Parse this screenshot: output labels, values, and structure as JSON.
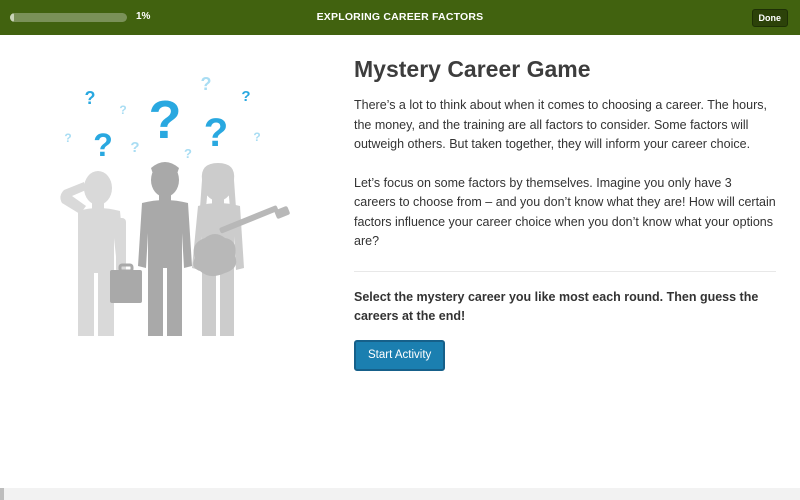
{
  "header": {
    "progress": {
      "value": 0.01,
      "label": "1%"
    },
    "title": "EXPLORING CAREER FACTORS",
    "done_label": "Done"
  },
  "colors": {
    "header_bg": "#41620f",
    "button_blue": "#1b7fb0",
    "question_blue": "#29a8e0",
    "silhouette_gray": "#cfcfcf"
  },
  "illustration": {
    "icons": [
      "question-mark-icon",
      "person-thinking-silhouette",
      "person-briefcase-silhouette",
      "person-guitar-silhouette"
    ]
  },
  "main": {
    "title": "Mystery Career Game",
    "paragraphs": [
      "There’s a lot to think about when it comes to choosing a career. The hours, the money, and the training are all factors to consider. Some factors will outweigh others. But taken together, they will inform your career choice.",
      "Let’s focus on some factors by themselves. Imagine you only have 3 careers to choose from – and you don’t know what they are! How will certain factors influence your career choice when you don’t know what your options are?"
    ],
    "instruction": "Select the mystery career you like most each round. Then guess the careers at the end!",
    "start_label": "Start Activity"
  }
}
